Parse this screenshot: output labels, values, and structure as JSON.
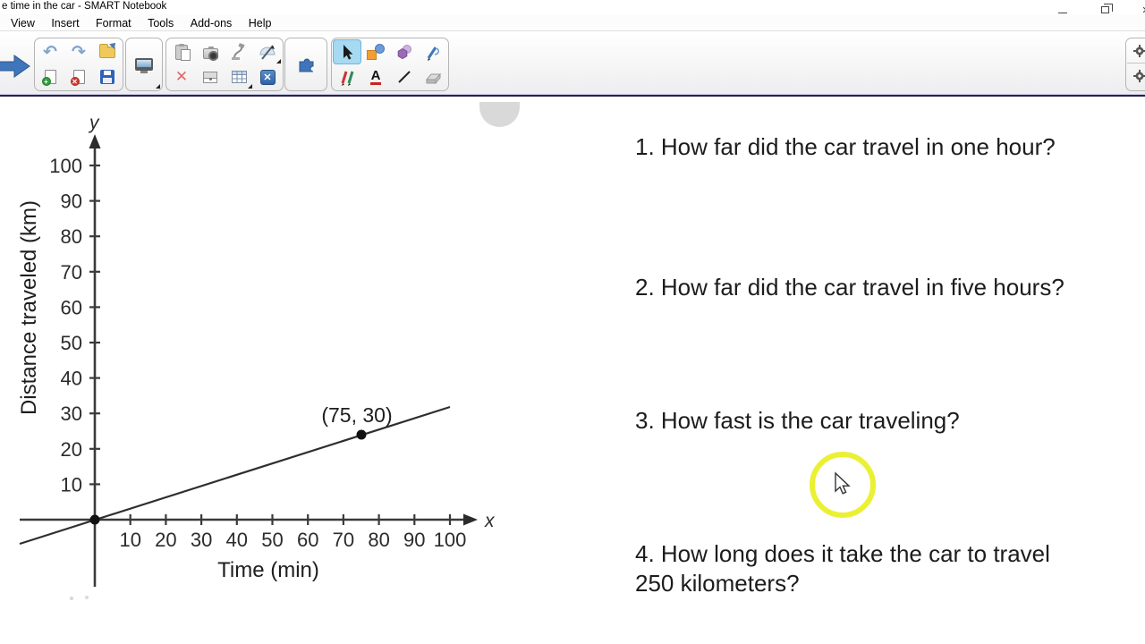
{
  "window": {
    "title": "e time in the car - SMART Notebook"
  },
  "menu": {
    "items": [
      "View",
      "Insert",
      "Format",
      "Tools",
      "Add-ons",
      "Help"
    ]
  },
  "toolbar": {
    "active_tool": "select",
    "buttons": [
      "next-page",
      "undo",
      "redo",
      "open",
      "new-page",
      "delete-page",
      "save",
      "display",
      "paste",
      "screen-capture",
      "document-camera",
      "measurement-tools",
      "delete",
      "screen-shade",
      "table",
      "hide",
      "add-ons",
      "select",
      "shapes",
      "regular-polygons",
      "magic-pen",
      "pens",
      "text",
      "lines",
      "eraser",
      "settings-top",
      "settings-bottom"
    ],
    "glyphs": {
      "undo": "↶",
      "redo": "↷",
      "delete": "✕",
      "hide": "✕"
    }
  },
  "questions": [
    {
      "text": "1. How far did the car travel in one hour?"
    },
    {
      "text": "2. How far did the car travel in five hours?"
    },
    {
      "text": "3. How fast is the car traveling?"
    },
    {
      "text": "4. How long does it take the car to travel\n250 kilometers?"
    }
  ],
  "chart_data": {
    "type": "line",
    "xlabel": "Time (min)",
    "ylabel": "Distance traveled (km)",
    "x_axis_letter": "x",
    "y_axis_letter": "y",
    "x_ticks": [
      10,
      20,
      30,
      40,
      50,
      60,
      70,
      80,
      90,
      100
    ],
    "y_ticks": [
      10,
      20,
      30,
      40,
      50,
      60,
      70,
      80,
      90,
      100
    ],
    "xlim": [
      0,
      105
    ],
    "ylim": [
      0,
      105
    ],
    "grid": false,
    "series": [
      {
        "name": "distance-vs-time",
        "points": [
          [
            0,
            0
          ],
          [
            75,
            30
          ]
        ],
        "through_origin": true
      }
    ],
    "annotated_point": {
      "x": 75,
      "y": 30,
      "label": "(75, 30)"
    }
  },
  "colors": {
    "accent_blue": "#3f76bb",
    "highlight_yellow": "#eaef28",
    "toolbar_border_navy": "#23234f",
    "select_active_bg": "#a6d9f2"
  }
}
